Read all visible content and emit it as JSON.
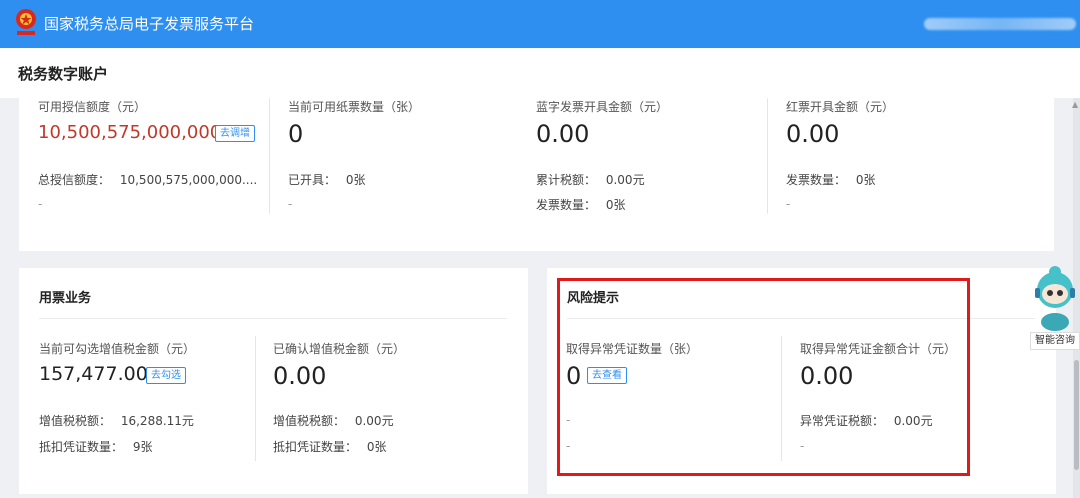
{
  "topbar": {
    "brand": "国家税务总局电子发票服务平台",
    "user_name": ""
  },
  "header": {
    "title": "税务数字账户"
  },
  "credit": {
    "label": "可用授信额度（元）",
    "value": "10,500,575,000,000.00",
    "action": "去调增",
    "total_label": "总授信额度：",
    "total_value": "10,500,575,000,000....",
    "extra": "-"
  },
  "paper_tickets": {
    "label": "当前可用纸票数量（张）",
    "value": "0",
    "issued_label": "已开具：",
    "issued_value": "0张",
    "extra": "-"
  },
  "blue_invoice": {
    "label": "蓝字发票开具金额（元）",
    "value": "0.00",
    "tax_label": "累计税额：",
    "tax_value": "0.00元",
    "count_label": "发票数量：",
    "count_value": "0张"
  },
  "red_invoice": {
    "label": "红票开具金额（元）",
    "value": "0.00",
    "count_label": "发票数量：",
    "count_value": "0张",
    "extra": "-"
  },
  "use_business": {
    "title": "用票业务",
    "selectable": {
      "label": "当前可勾选增值税金额（元）",
      "value": "157,477.00",
      "action": "去勾选",
      "tax_label": "增值税税额：",
      "tax_value": "16,288.11元",
      "voucher_label": "抵扣凭证数量：",
      "voucher_value": "9张"
    },
    "confirmed": {
      "label": "已确认增值税金额（元）",
      "value": "0.00",
      "tax_label": "增值税税额：",
      "tax_value": "0.00元",
      "voucher_label": "抵扣凭证数量：",
      "voucher_value": "0张"
    }
  },
  "risk": {
    "title": "风险提示",
    "abnormal_count": {
      "label": "取得异常凭证数量（张）",
      "value": "0",
      "action": "去查看",
      "extra1": "-",
      "extra2": "-"
    },
    "abnormal_amount": {
      "label": "取得异常凭证金额合计（元）",
      "value": "0.00",
      "tax_label": "异常凭证税额：",
      "tax_value": "0.00元",
      "extra": "-"
    }
  },
  "assistant": {
    "label": "智能咨询"
  },
  "colors": {
    "primary": "#2f8ff0",
    "amount_red": "#c0392b",
    "highlight": "#e01a1a"
  }
}
